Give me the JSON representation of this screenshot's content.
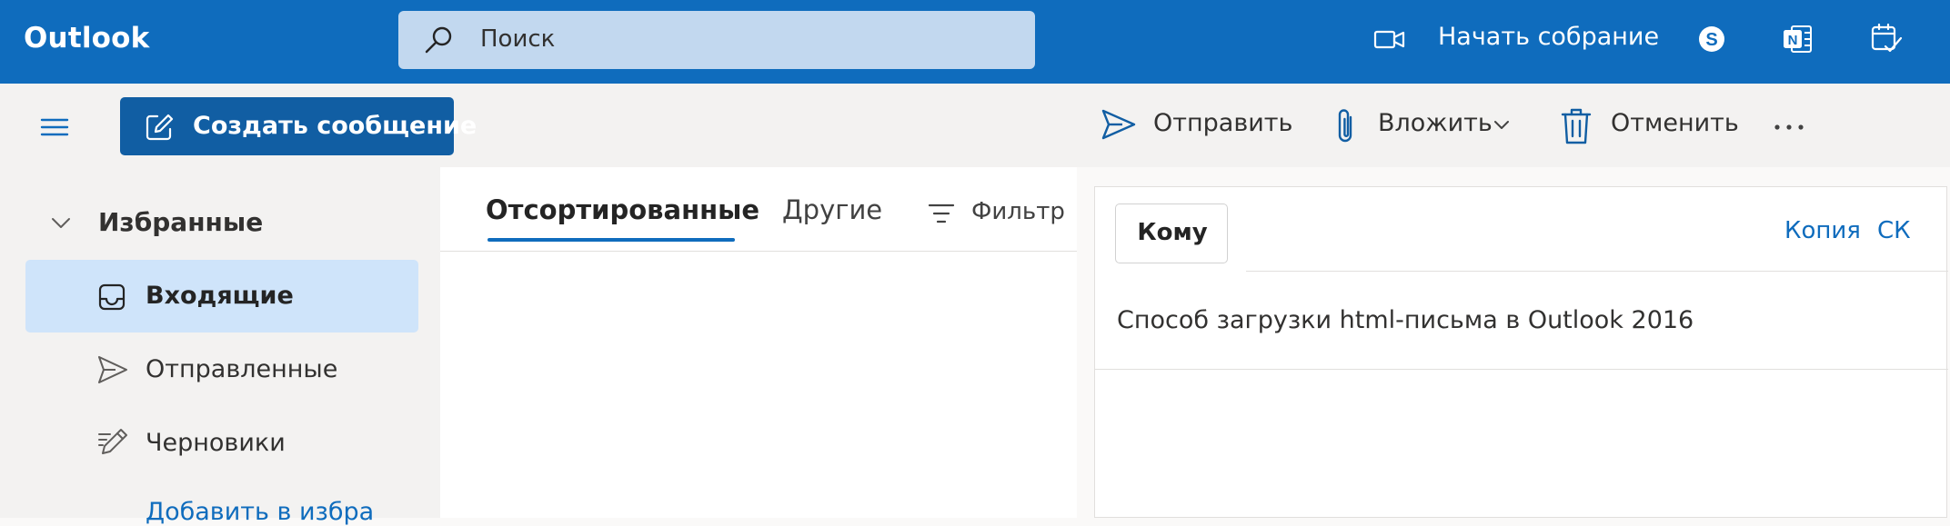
{
  "header": {
    "brand": "Outlook",
    "search": {
      "placeholder": "Поиск"
    },
    "meet_now_label": "Начать собрание"
  },
  "command_bar": {
    "new_message_label": "Создать сообщение",
    "send_label": "Отправить",
    "attach_label": "Вложить",
    "discard_label": "Отменить"
  },
  "nav": {
    "favorites_label": "Избранные",
    "items": [
      {
        "label": "Входящие",
        "icon": "inbox-icon",
        "selected": true
      },
      {
        "label": "Отправленные",
        "icon": "send-icon",
        "selected": false
      },
      {
        "label": "Черновики",
        "icon": "draft-icon",
        "selected": false
      }
    ],
    "add_favorite_label": "Добавить в избра"
  },
  "message_list": {
    "tabs": [
      {
        "label": "Отсортированные",
        "active": true
      },
      {
        "label": "Другие",
        "active": false
      }
    ],
    "filter_label": "Фильтр"
  },
  "compose": {
    "to_label": "Кому",
    "cc_label": "Копия",
    "bcc_label": "СК",
    "subject": "Способ загрузки html-письма в Outlook 2016"
  },
  "colors": {
    "brand_blue": "#0f6cbd",
    "new_message_blue": "#115ea3",
    "selected_nav": "#cfe4fa",
    "search_field": "#c2d8ef"
  }
}
